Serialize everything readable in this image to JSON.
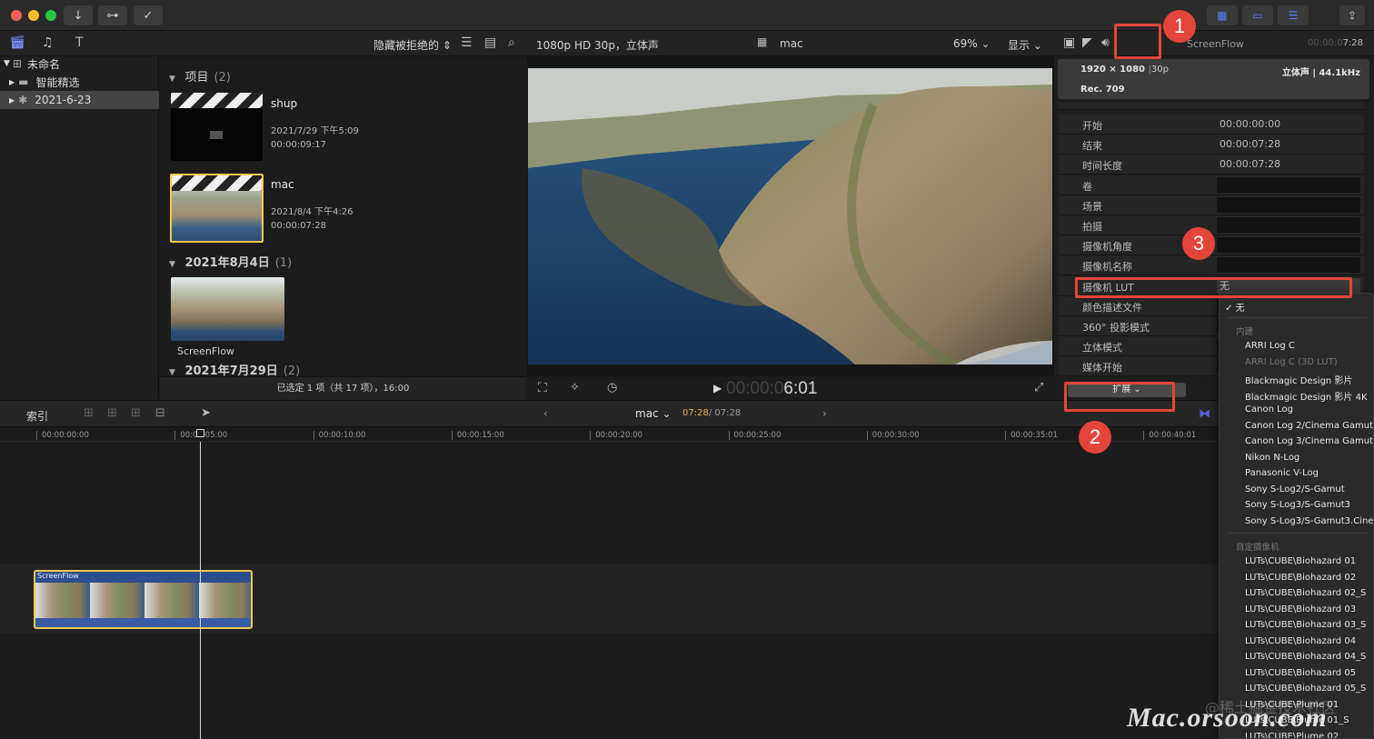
{
  "toolbar": {
    "hide_rejected": "隐藏被拒绝的",
    "viewer_format": "1080p HD 30p，立体声",
    "viewer_clip": "mac",
    "zoom": "69%",
    "display": "显示",
    "insp_clip_name": "ScreenFlow",
    "insp_time_dim": "00:00:0",
    "insp_time": "7:28"
  },
  "libraries": [
    {
      "label": "未命名"
    },
    {
      "label": "智能精选"
    },
    {
      "label": "2021-6-23"
    }
  ],
  "browser": {
    "section_projects": {
      "title": "项目",
      "count": "(2)"
    },
    "clips": [
      {
        "name": "shup",
        "date": "2021/7/29 下午5:09",
        "duration": "00:00:09:17"
      },
      {
        "name": "mac",
        "date": "2021/8/4 下午4:26",
        "duration": "00:00:07:28"
      }
    ],
    "section_aug": {
      "title": "2021年8月4日",
      "count": "(1)"
    },
    "aug_clip_label": "ScreenFlow",
    "section_jul": {
      "title": "2021年7月29日",
      "count": "(2)"
    },
    "status": "已选定 1 项（共 17 项），16:00"
  },
  "viewer": {
    "timecode_dim": "00:00:0",
    "timecode": "6:01"
  },
  "inspector": {
    "resolution": "1920 × 1080",
    "fps": "30p",
    "audio": "立体声 | 44.1kHz",
    "color_space": "Rec. 709",
    "rows": [
      {
        "label": "开始",
        "value": "00:00:00:00"
      },
      {
        "label": "结束",
        "value": "00:00:07:28"
      },
      {
        "label": "时间长度",
        "value": "00:00:07:28"
      },
      {
        "label": "卷",
        "value": ""
      },
      {
        "label": "场景",
        "value": ""
      },
      {
        "label": "拍摄",
        "value": ""
      },
      {
        "label": "摄像机角度",
        "value": ""
      },
      {
        "label": "摄像机名称",
        "value": ""
      },
      {
        "label": "摄像机 LUT",
        "value": "无"
      },
      {
        "label": "颜色描述文件",
        "value": ""
      },
      {
        "label": "360° 投影模式",
        "value": ""
      },
      {
        "label": "立体模式",
        "value": ""
      },
      {
        "label": "媒体开始",
        "value": ""
      }
    ],
    "expand_button": "扩展"
  },
  "lut_menu": {
    "checked": "无",
    "builtin_header": "内建",
    "builtin": [
      {
        "label": "ARRI Log C",
        "disabled": false
      },
      {
        "label": "ARRI Log C (3D LUT)",
        "disabled": true
      },
      {
        "label": "Blackmagic Design 影片",
        "disabled": false
      },
      {
        "label": "Blackmagic Design 影片 4K",
        "disabled": false
      },
      {
        "label": "Canon Log",
        "disabled": false
      },
      {
        "label": "Canon Log 2/Cinema Gamut",
        "disabled": false
      },
      {
        "label": "Canon Log 3/Cinema Gamut",
        "disabled": false
      },
      {
        "label": "Nikon N-Log",
        "disabled": false
      },
      {
        "label": "Panasonic V-Log",
        "disabled": false
      },
      {
        "label": "Sony S-Log2/S-Gamut",
        "disabled": false
      },
      {
        "label": "Sony S-Log3/S-Gamut3",
        "disabled": false
      },
      {
        "label": "Sony S-Log3/S-Gamut3.Cine",
        "disabled": false
      }
    ],
    "custom_header": "自定摄像机",
    "custom": [
      "LUTs\\CUBE\\Biohazard 01",
      "LUTs\\CUBE\\Biohazard 02",
      "LUTs\\CUBE\\Biohazard 02_S",
      "LUTs\\CUBE\\Biohazard 03",
      "LUTs\\CUBE\\Biohazard 03_S",
      "LUTs\\CUBE\\Biohazard 04",
      "LUTs\\CUBE\\Biohazard 04_S",
      "LUTs\\CUBE\\Biohazard 05",
      "LUTs\\CUBE\\Biohazard 05_S",
      "LUTs\\CUBE\\Plume 01",
      "LUTs\\CUBE\\Plume 01_S",
      "LUTs\\CUBE\\Plume 02"
    ]
  },
  "timeline": {
    "index_label": "索引",
    "project_name": "mac",
    "time_current": "07:28",
    "time_total": "/ 07:28",
    "ruler": [
      "00:00:00:00",
      "00:00:05:00",
      "00:00:10:00",
      "00:00:15:00",
      "00:00:20:00",
      "00:00:25:00",
      "00:00:30:00",
      "00:00:35:01",
      "00:00:40:01"
    ],
    "clip_label": "ScreenFlow"
  },
  "callouts": [
    "1",
    "2",
    "3"
  ],
  "watermark": "Mac.orsoon.com",
  "watermark_sub": "@稀土掘金技术社区",
  "colors": {
    "accent_red": "#e4453a",
    "selection_yellow": "#f2c94c",
    "inspector_blue": "#4a7dff"
  }
}
